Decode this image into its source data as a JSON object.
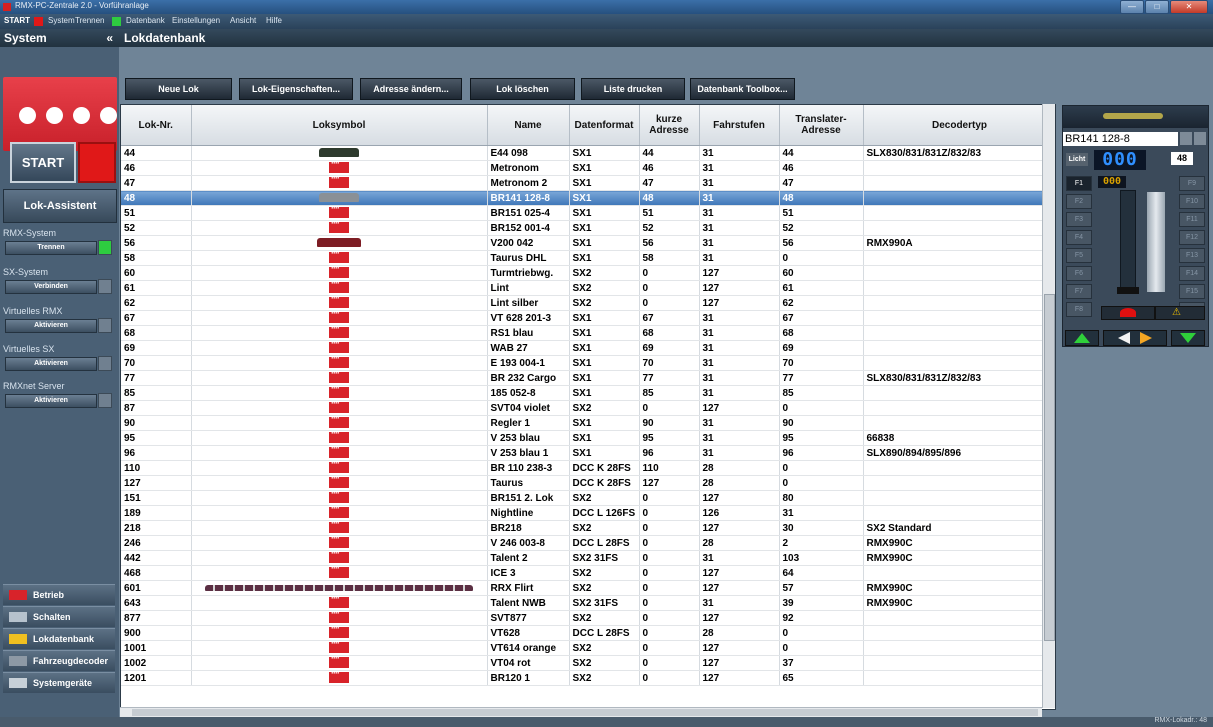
{
  "window": {
    "title": "RMX-PC-Zentrale 2.0 - Vorführanlage",
    "controls": [
      "—",
      "□",
      "✕"
    ]
  },
  "menubar": {
    "start": "START",
    "items": [
      "System",
      "Trennen",
      "Datenbank",
      "Einstellungen",
      "Ansicht",
      "Hilfe"
    ],
    "led_colors": {
      "red": "#e01818",
      "green": "#2ecc40"
    }
  },
  "sidebar": {
    "title": "System",
    "collapse": "«",
    "start_button": "START",
    "lok_assistent": "Lok-Assistent",
    "groups": [
      {
        "label": "RMX-System",
        "button": "Trennen",
        "led": "green"
      },
      {
        "label": "SX-System",
        "button": "Verbinden",
        "led": "gray"
      },
      {
        "label": "Virtuelles RMX",
        "button": "Aktivieren",
        "led": "gray"
      },
      {
        "label": "Virtuelles SX",
        "button": "Aktivieren",
        "led": "gray"
      },
      {
        "label": "RMXnet Server",
        "button": "Aktivieren",
        "led": "gray"
      }
    ],
    "nav": [
      {
        "label": "Betrieb",
        "icon": "rmx-icon"
      },
      {
        "label": "Schalten",
        "icon": "switch-icon"
      },
      {
        "label": "Lokdatenbank",
        "icon": "folder-icon"
      },
      {
        "label": "Fahrzeugdecoder",
        "icon": "decoder-icon"
      },
      {
        "label": "Systemgeräte",
        "icon": "device-icon"
      }
    ]
  },
  "main": {
    "title": "Lokdatenbank",
    "toolbar": [
      "Neue Lok",
      "Lok-Eigenschaften...",
      "Adresse ändern...",
      "Lok löschen",
      "Liste drucken",
      "Datenbank Toolbox..."
    ]
  },
  "table": {
    "columns": [
      "Lok-Nr.",
      "Loksymbol",
      "Name",
      "Datenformat",
      "kurze Adresse",
      "Fahrstufen",
      "Translater-Adresse",
      "Decodertyp"
    ],
    "selected_index": 3,
    "rows": [
      {
        "nr": "44",
        "sym": "loco-dark",
        "name": "E44 098",
        "fmt": "SX1",
        "kurz": "44",
        "fs": "31",
        "trans": "44",
        "dec": "SLX830/831/831Z/832/83"
      },
      {
        "nr": "46",
        "sym": "red",
        "name": "Metronom",
        "fmt": "SX1",
        "kurz": "46",
        "fs": "31",
        "trans": "46",
        "dec": ""
      },
      {
        "nr": "47",
        "sym": "red",
        "name": "Metronom 2",
        "fmt": "SX1",
        "kurz": "47",
        "fs": "31",
        "trans": "47",
        "dec": ""
      },
      {
        "nr": "48",
        "sym": "loco-gray",
        "name": "BR141 128-8",
        "fmt": "SX1",
        "kurz": "48",
        "fs": "31",
        "trans": "48",
        "dec": ""
      },
      {
        "nr": "51",
        "sym": "red",
        "name": "BR151 025-4",
        "fmt": "SX1",
        "kurz": "51",
        "fs": "31",
        "trans": "51",
        "dec": ""
      },
      {
        "nr": "52",
        "sym": "red",
        "name": "BR152 001-4",
        "fmt": "SX1",
        "kurz": "52",
        "fs": "31",
        "trans": "52",
        "dec": ""
      },
      {
        "nr": "56",
        "sym": "loco-wine",
        "name": "V200 042",
        "fmt": "SX1",
        "kurz": "56",
        "fs": "31",
        "trans": "56",
        "dec": "RMX990A"
      },
      {
        "nr": "58",
        "sym": "red",
        "name": "Taurus DHL",
        "fmt": "SX1",
        "kurz": "58",
        "fs": "31",
        "trans": "0",
        "dec": ""
      },
      {
        "nr": "60",
        "sym": "red",
        "name": "Turmtriebwg.",
        "fmt": "SX2",
        "kurz": "0",
        "fs": "127",
        "trans": "60",
        "dec": ""
      },
      {
        "nr": "61",
        "sym": "red",
        "name": "Lint",
        "fmt": "SX2",
        "kurz": "0",
        "fs": "127",
        "trans": "61",
        "dec": ""
      },
      {
        "nr": "62",
        "sym": "red",
        "name": "Lint silber",
        "fmt": "SX2",
        "kurz": "0",
        "fs": "127",
        "trans": "62",
        "dec": ""
      },
      {
        "nr": "67",
        "sym": "red",
        "name": "VT 628 201-3",
        "fmt": "SX1",
        "kurz": "67",
        "fs": "31",
        "trans": "67",
        "dec": ""
      },
      {
        "nr": "68",
        "sym": "red",
        "name": "RS1 blau",
        "fmt": "SX1",
        "kurz": "68",
        "fs": "31",
        "trans": "68",
        "dec": ""
      },
      {
        "nr": "69",
        "sym": "red",
        "name": "WAB 27",
        "fmt": "SX1",
        "kurz": "69",
        "fs": "31",
        "trans": "69",
        "dec": ""
      },
      {
        "nr": "70",
        "sym": "red",
        "name": "E 193 004-1",
        "fmt": "SX1",
        "kurz": "70",
        "fs": "31",
        "trans": "70",
        "dec": ""
      },
      {
        "nr": "77",
        "sym": "red",
        "name": "BR 232 Cargo",
        "fmt": "SX1",
        "kurz": "77",
        "fs": "31",
        "trans": "77",
        "dec": "SLX830/831/831Z/832/83"
      },
      {
        "nr": "85",
        "sym": "red",
        "name": "185 052-8",
        "fmt": "SX1",
        "kurz": "85",
        "fs": "31",
        "trans": "85",
        "dec": ""
      },
      {
        "nr": "87",
        "sym": "red",
        "name": "SVT04 violet",
        "fmt": "SX2",
        "kurz": "0",
        "fs": "127",
        "trans": "0",
        "dec": ""
      },
      {
        "nr": "90",
        "sym": "red",
        "name": "Regler 1",
        "fmt": "SX1",
        "kurz": "90",
        "fs": "31",
        "trans": "90",
        "dec": ""
      },
      {
        "nr": "95",
        "sym": "red",
        "name": "V 253 blau",
        "fmt": "SX1",
        "kurz": "95",
        "fs": "31",
        "trans": "95",
        "dec": "66838"
      },
      {
        "nr": "96",
        "sym": "red",
        "name": "V 253 blau 1",
        "fmt": "SX1",
        "kurz": "96",
        "fs": "31",
        "trans": "96",
        "dec": "SLX890/894/895/896"
      },
      {
        "nr": "110",
        "sym": "red",
        "name": "BR 110 238-3",
        "fmt": "DCC K 28FS",
        "kurz": "110",
        "fs": "28",
        "trans": "0",
        "dec": ""
      },
      {
        "nr": "127",
        "sym": "red",
        "name": "Taurus",
        "fmt": "DCC K 28FS",
        "kurz": "127",
        "fs": "28",
        "trans": "0",
        "dec": ""
      },
      {
        "nr": "151",
        "sym": "red",
        "name": "BR151 2. Lok",
        "fmt": "SX2",
        "kurz": "0",
        "fs": "127",
        "trans": "80",
        "dec": ""
      },
      {
        "nr": "189",
        "sym": "red",
        "name": "Nightline",
        "fmt": "DCC L 126FS",
        "kurz": "0",
        "fs": "126",
        "trans": "31",
        "dec": ""
      },
      {
        "nr": "218",
        "sym": "red",
        "name": "BR218",
        "fmt": "SX2",
        "kurz": "0",
        "fs": "127",
        "trans": "30",
        "dec": "SX2 Standard"
      },
      {
        "nr": "246",
        "sym": "red",
        "name": "V 246 003-8",
        "fmt": "DCC L 28FS",
        "kurz": "0",
        "fs": "28",
        "trans": "2",
        "dec": "RMX990C"
      },
      {
        "nr": "442",
        "sym": "red",
        "name": "Talent 2",
        "fmt": "SX2 31FS",
        "kurz": "0",
        "fs": "31",
        "trans": "103",
        "dec": "RMX990C"
      },
      {
        "nr": "468",
        "sym": "red",
        "name": "ICE 3",
        "fmt": "SX2",
        "kurz": "0",
        "fs": "127",
        "trans": "64",
        "dec": ""
      },
      {
        "nr": "601",
        "sym": "loco-long",
        "name": "RRX Flirt",
        "fmt": "SX2",
        "kurz": "0",
        "fs": "127",
        "trans": "57",
        "dec": "RMX990C"
      },
      {
        "nr": "643",
        "sym": "red",
        "name": "Talent NWB",
        "fmt": "SX2 31FS",
        "kurz": "0",
        "fs": "31",
        "trans": "39",
        "dec": "RMX990C"
      },
      {
        "nr": "877",
        "sym": "red",
        "name": "SVT877",
        "fmt": "SX2",
        "kurz": "0",
        "fs": "127",
        "trans": "92",
        "dec": ""
      },
      {
        "nr": "900",
        "sym": "red",
        "name": "VT628",
        "fmt": "DCC L 28FS",
        "kurz": "0",
        "fs": "28",
        "trans": "0",
        "dec": ""
      },
      {
        "nr": "1001",
        "sym": "red",
        "name": "VT614 orange",
        "fmt": "SX2",
        "kurz": "0",
        "fs": "127",
        "trans": "0",
        "dec": ""
      },
      {
        "nr": "1002",
        "sym": "red",
        "name": "VT04 rot",
        "fmt": "SX2",
        "kurz": "0",
        "fs": "127",
        "trans": "37",
        "dec": ""
      },
      {
        "nr": "1201",
        "sym": "red",
        "name": "BR120 1",
        "fmt": "SX2",
        "kurz": "0",
        "fs": "127",
        "trans": "65",
        "dec": ""
      }
    ]
  },
  "throttle": {
    "loco_name": "BR141 128-8",
    "licht": "Licht",
    "speed": "000",
    "steps": "48",
    "function_digits": "000",
    "function_keys_left": [
      "F1",
      "F2",
      "F3",
      "F4",
      "F5",
      "F6",
      "F7",
      "F8"
    ],
    "function_keys_right": [
      "F9",
      "F10",
      "F11",
      "F12",
      "F13",
      "F14",
      "F15",
      "F16"
    ]
  },
  "statusbar": {
    "text": "RMX-Lokadr.: 48"
  }
}
